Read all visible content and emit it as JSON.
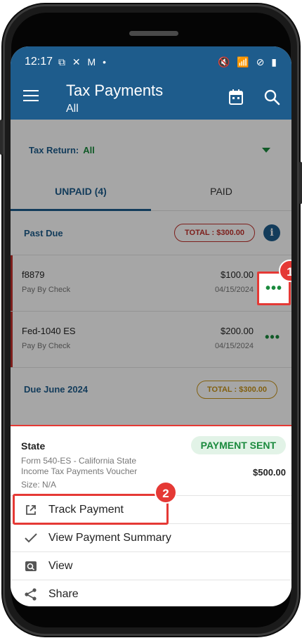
{
  "status_bar": {
    "time": "12:17",
    "left_icons": "⧉ ✕ M •",
    "right_icons": "🔇 📶 ⊘ ▮"
  },
  "app_bar": {
    "title": "Tax Payments",
    "subtitle": "All"
  },
  "filter": {
    "label": "Tax Return:",
    "value": "All"
  },
  "tabs": [
    {
      "label": "UNPAID (4)"
    },
    {
      "label": "PAID"
    }
  ],
  "sections": {
    "past_due": {
      "label": "Past Due",
      "total": "TOTAL : $300.00"
    },
    "due_june": {
      "label": "Due June 2024",
      "total": "TOTAL : $300.00"
    }
  },
  "payments": [
    {
      "name": "f8879",
      "method": "Pay By Check",
      "amount": "$100.00",
      "date": "04/15/2024"
    },
    {
      "name": "Fed-1040 ES",
      "method": "Pay By Check",
      "amount": "$200.00",
      "date": "04/15/2024"
    }
  ],
  "sheet": {
    "title": "State",
    "status": "PAYMENT SENT",
    "form": "Form 540-ES - California State Income Tax Payments Voucher",
    "size": "Size: N/A",
    "amount": "$500.00",
    "actions": [
      {
        "label": "Track Payment"
      },
      {
        "label": "View Payment Summary"
      },
      {
        "label": "View"
      },
      {
        "label": "Share"
      }
    ]
  },
  "annotations": {
    "step1": "1",
    "step2": "2"
  },
  "colors": {
    "primary": "#1e5c8c",
    "accent_green": "#1a8a3d",
    "alert_red": "#e53935"
  }
}
